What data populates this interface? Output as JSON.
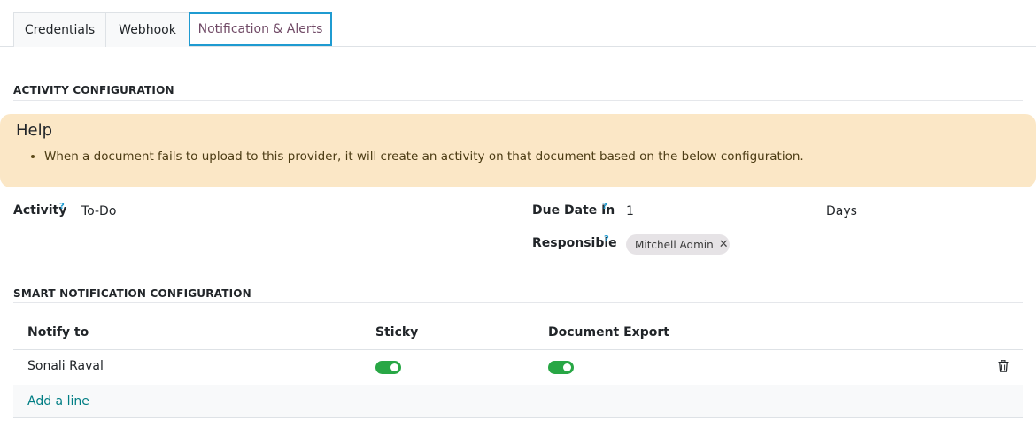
{
  "tabs": [
    {
      "label": "Credentials"
    },
    {
      "label": "Webhook"
    },
    {
      "label": "Notification & Alerts"
    }
  ],
  "activity_section": {
    "title": "ACTIVITY CONFIGURATION",
    "help": {
      "title": "Help",
      "bullet": "When a document fails to upload to this provider, it will create an activity on that document based on the below configuration."
    },
    "activity": {
      "label": "Activity",
      "help_mark": "?",
      "value": "To-Do"
    },
    "due_date": {
      "label": "Due Date In",
      "help_mark": "?",
      "value": "1",
      "unit": "Days"
    },
    "responsible": {
      "label": "Responsible",
      "help_mark": "?",
      "tag": "Mitchell Admin",
      "remove": "✕"
    }
  },
  "notification_section": {
    "title": "SMART NOTIFICATION CONFIGURATION",
    "columns": [
      "Notify to",
      "Sticky",
      "Document Export"
    ],
    "rows": [
      {
        "notify_to": "Sonali Raval",
        "sticky": true,
        "document_export": true
      }
    ],
    "add_line": "Add a line"
  },
  "colors": {
    "accent": "#1f9bd1",
    "active_tab_text": "#714b67",
    "help_bg": "#fbe7c6",
    "toggle_on": "#28a745",
    "link": "#017e84"
  },
  "icons": {
    "row_delete": "trash-icon"
  }
}
